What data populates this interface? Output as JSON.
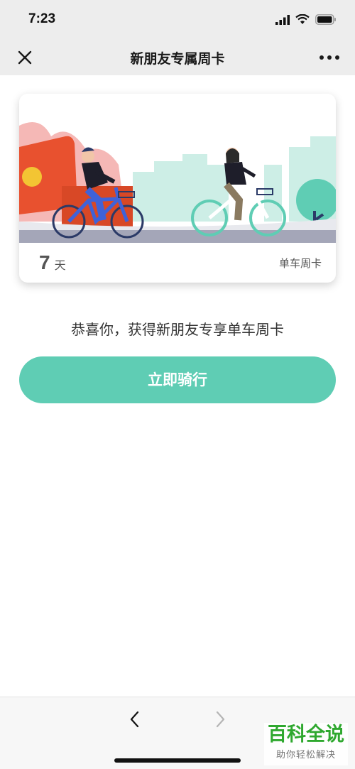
{
  "status_bar": {
    "time": "7:23"
  },
  "nav": {
    "title": "新朋友专属周卡"
  },
  "card": {
    "days_number": "7",
    "days_unit": "天",
    "type": "单车周卡"
  },
  "content": {
    "congrats_text": "恭喜你，获得新朋友专享单车周卡",
    "ride_button": "立即骑行"
  },
  "watermark": {
    "main": "百科全说",
    "sub": "助你轻松解决"
  },
  "colors": {
    "accent": "#5fcdb4",
    "nav_background": "#ededed",
    "watermark_green": "#2fa82f"
  }
}
